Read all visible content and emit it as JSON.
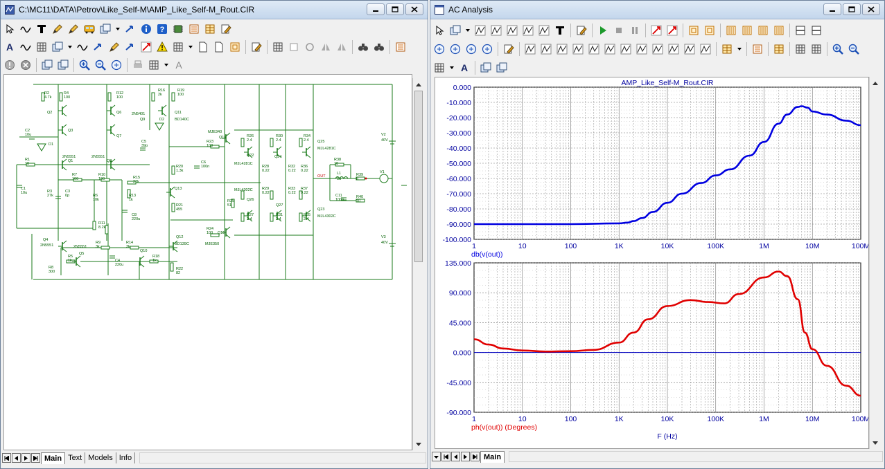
{
  "left_window": {
    "title": "C:\\MC11\\DATA\\Petrov\\Like_Self-M\\AMP_Like_Self-M_Rout.CIR",
    "tabs": [
      "Main",
      "Text",
      "Models",
      "Info"
    ],
    "schematic": {
      "resistors": [
        {
          "name": "R2",
          "value": "4.7k"
        },
        {
          "name": "R4",
          "value": "100"
        },
        {
          "name": "R12",
          "value": "100"
        },
        {
          "name": "R16",
          "value": "2k"
        },
        {
          "name": "R19",
          "value": "100"
        },
        {
          "name": "R1",
          "value": "10"
        },
        {
          "name": "R7",
          "value": "100"
        },
        {
          "name": "R10",
          "value": "100"
        },
        {
          "name": "R3",
          "value": "27k"
        },
        {
          "name": "R6",
          "value": "10k"
        },
        {
          "name": "R15",
          "value": "27k"
        },
        {
          "name": "R13",
          "value": "1k"
        },
        {
          "name": "R20",
          "value": "1.3k"
        },
        {
          "name": "R21",
          "value": "455"
        },
        {
          "name": "R23",
          "value": "100"
        },
        {
          "name": "R24",
          "value": "100"
        },
        {
          "name": "R11",
          "value": "8.2k"
        },
        {
          "name": "R9",
          "value": "3k"
        },
        {
          "name": "R14",
          "value": "3k"
        },
        {
          "name": "R5",
          "value": "1k"
        },
        {
          "name": "R8",
          "value": "300"
        },
        {
          "name": "R18",
          "value": "1k"
        },
        {
          "name": "R22",
          "value": "82"
        },
        {
          "name": "R26",
          "value": "2.4"
        },
        {
          "name": "R30",
          "value": "2.4"
        },
        {
          "name": "R34",
          "value": "2.4"
        },
        {
          "name": "R28",
          "value": "0.22"
        },
        {
          "name": "R32",
          "value": "0.22"
        },
        {
          "name": "R36",
          "value": "0.22"
        },
        {
          "name": "R29",
          "value": "0.22"
        },
        {
          "name": "R33",
          "value": "0.22"
        },
        {
          "name": "R37",
          "value": "0.22"
        },
        {
          "name": "R25",
          "value": "51"
        },
        {
          "name": "R27",
          "value": "2.4"
        },
        {
          "name": "R31",
          "value": "2.4"
        },
        {
          "name": "R35",
          "value": "2.4"
        },
        {
          "name": "R38",
          "value": "10"
        },
        {
          "name": "R39",
          "value": "8"
        },
        {
          "name": "R40",
          "value": "10"
        }
      ],
      "capacitors": [
        {
          "name": "C2",
          "value": "10u"
        },
        {
          "name": "C1",
          "value": "10u"
        },
        {
          "name": "C3",
          "value": "0p"
        },
        {
          "name": "C5",
          "value": "39p"
        },
        {
          "name": "C6",
          "value": "100n"
        },
        {
          "name": "C8",
          "value": "220u"
        },
        {
          "name": "C4",
          "value": "220u"
        },
        {
          "name": "C11",
          "value": "100n"
        }
      ],
      "transistors": [
        {
          "name": "Q2",
          "type": ""
        },
        {
          "name": "Q6",
          "type": ""
        },
        {
          "name": "Q3",
          "type": ""
        },
        {
          "name": "Q7",
          "type": ""
        },
        {
          "name": "Q1",
          "type": "2N5551"
        },
        {
          "name": "Q8",
          "type": "2N5551"
        },
        {
          "name": "Q9",
          "type": "2N5401"
        },
        {
          "name": "Q11",
          "type": "BD140C"
        },
        {
          "name": "Q13",
          "type": ""
        },
        {
          "name": "Q14",
          "type": "MJE340"
        },
        {
          "name": "Q4",
          "type": "2N5551"
        },
        {
          "name": "Q5",
          "type": "2N5551"
        },
        {
          "name": "Q10",
          "type": ""
        },
        {
          "name": "Q12",
          "type": "BD139C"
        },
        {
          "name": "Q15",
          "type": "MJE350"
        },
        {
          "name": "Q22",
          "type": "MJL4281C"
        },
        {
          "name": "Q24",
          "type": ""
        },
        {
          "name": "Q25",
          "type": "MJL4281C"
        },
        {
          "name": "Q26",
          "type": "MJL4302C"
        },
        {
          "name": "Q27",
          "type": ""
        },
        {
          "name": "Q23",
          "type": "MJL4302C"
        }
      ],
      "others": [
        {
          "name": "D1"
        },
        {
          "name": "D2"
        },
        {
          "name": "L1",
          "value": "5u"
        },
        {
          "name": "V1"
        },
        {
          "name": "V2",
          "value": "40V"
        },
        {
          "name": "V3",
          "value": "40V"
        },
        {
          "name": "OUT"
        }
      ]
    }
  },
  "right_window": {
    "title": "AC Analysis",
    "tabs": [
      "Main"
    ],
    "chart_data": [
      {
        "type": "line",
        "title": "AMP_Like_Self-M_Rout.CIR",
        "xlabel": "",
        "ylabel": "",
        "xscale": "log",
        "xlim": [
          1,
          100000000
        ],
        "ylim": [
          -100,
          0
        ],
        "x_tick_labels": [
          "1",
          "10",
          "100",
          "1K",
          "10K",
          "100K",
          "1M",
          "10M",
          "100M"
        ],
        "y_tick_labels": [
          "0.000",
          "-10.000",
          "-20.000",
          "-30.000",
          "-40.000",
          "-50.000",
          "-60.000",
          "-70.000",
          "-80.000",
          "-90.000",
          "-100.000"
        ],
        "grid": true,
        "series": [
          {
            "name": "db(v(out))",
            "color": "#0000e0",
            "points": [
              [
                1,
                -90
              ],
              [
                100,
                -90
              ],
              [
                1000,
                -89.5
              ],
              [
                1500,
                -89
              ],
              [
                2000,
                -88
              ],
              [
                3000,
                -86
              ],
              [
                5000,
                -82
              ],
              [
                10000,
                -76
              ],
              [
                20000,
                -70
              ],
              [
                50000,
                -63
              ],
              [
                100000,
                -58
              ],
              [
                200000,
                -54
              ],
              [
                500000,
                -45
              ],
              [
                1000000,
                -36
              ],
              [
                2000000,
                -24
              ],
              [
                3000000,
                -18
              ],
              [
                5000000,
                -13
              ],
              [
                6000000,
                -12.5
              ],
              [
                8000000,
                -13.5
              ],
              [
                10000000,
                -16
              ],
              [
                20000000,
                -18
              ],
              [
                50000000,
                -22
              ],
              [
                100000000,
                -25
              ]
            ]
          }
        ]
      },
      {
        "type": "line",
        "title": "",
        "xlabel": "F (Hz)",
        "ylabel": "",
        "xscale": "log",
        "xlim": [
          1,
          100000000
        ],
        "ylim": [
          -90,
          135
        ],
        "x_tick_labels": [
          "1",
          "10",
          "100",
          "1K",
          "10K",
          "100K",
          "1M",
          "10M",
          "100M"
        ],
        "y_tick_labels": [
          "135.000",
          "90.000",
          "45.000",
          "0.000",
          "-45.000",
          "-90.000"
        ],
        "grid": true,
        "series": [
          {
            "name": "ph(v(out)) (Degrees)",
            "color": "#e00000",
            "points": [
              [
                1,
                20
              ],
              [
                2,
                12
              ],
              [
                4,
                6
              ],
              [
                10,
                3
              ],
              [
                30,
                1.5
              ],
              [
                100,
                2
              ],
              [
                300,
                4
              ],
              [
                1000,
                15
              ],
              [
                2000,
                30
              ],
              [
                4000,
                50
              ],
              [
                10000,
                70
              ],
              [
                30000,
                79
              ],
              [
                70000,
                76
              ],
              [
                150000,
                74
              ],
              [
                300000,
                88
              ],
              [
                1000000,
                113
              ],
              [
                2000000,
                122
              ],
              [
                3000000,
                115
              ],
              [
                5000000,
                80
              ],
              [
                7000000,
                30
              ],
              [
                10000000,
                5
              ],
              [
                20000000,
                -20
              ],
              [
                50000000,
                -50
              ],
              [
                100000000,
                -65
              ]
            ]
          }
        ]
      }
    ]
  }
}
